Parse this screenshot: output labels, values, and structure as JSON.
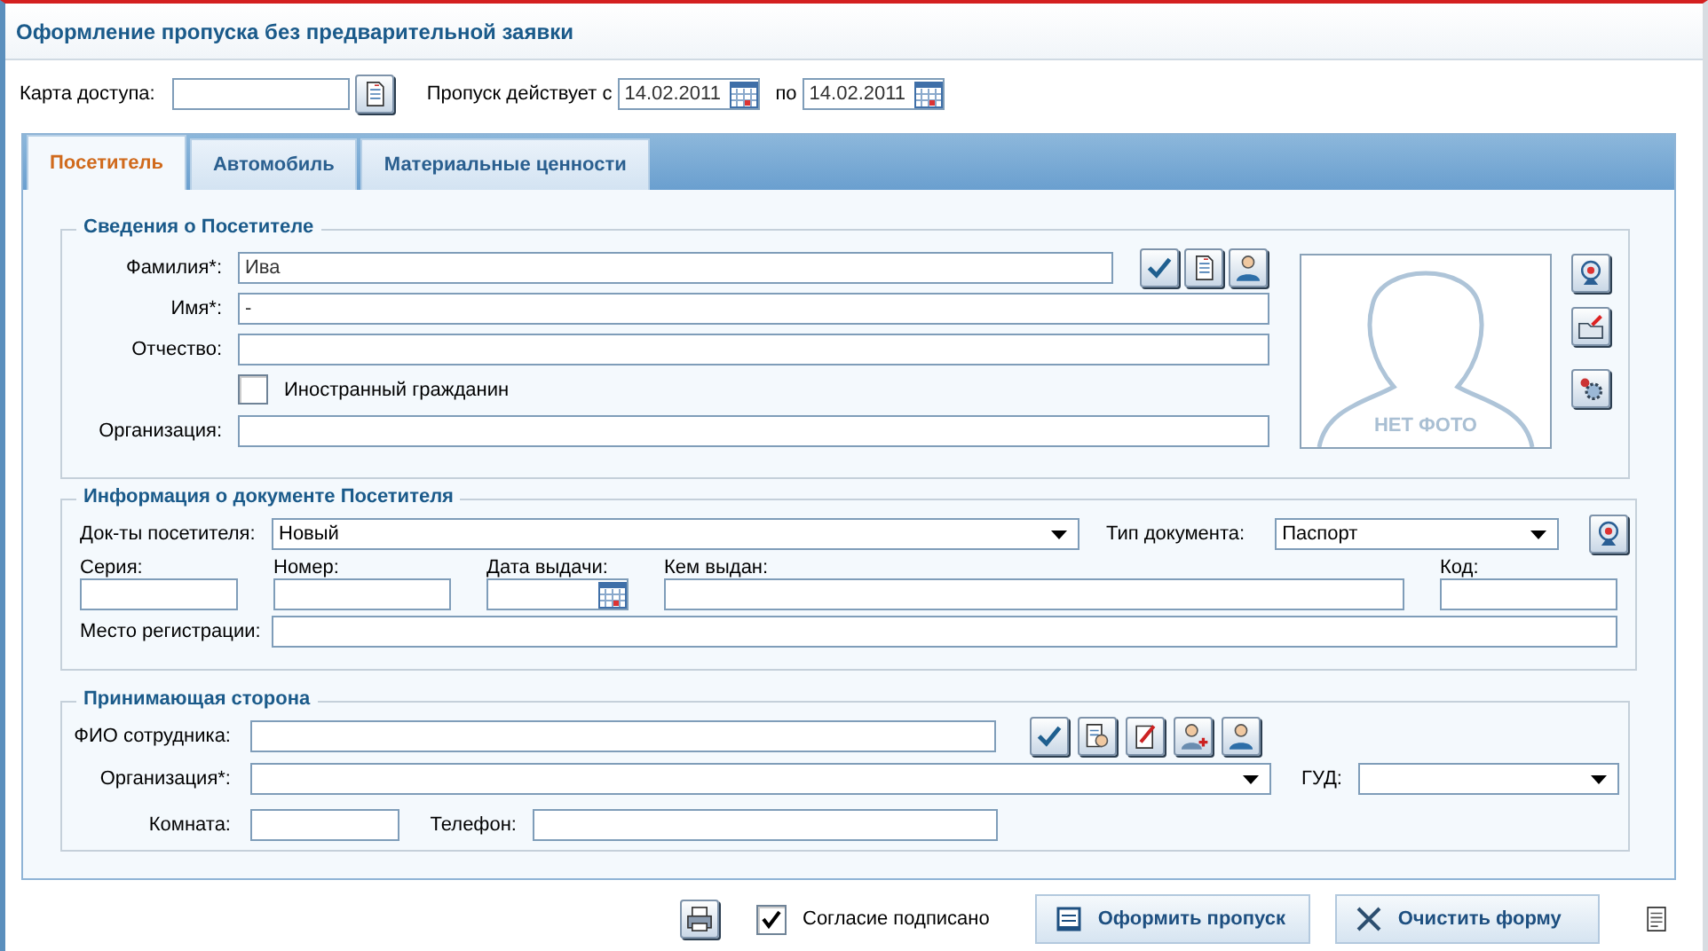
{
  "title": "Оформление пропуска без предварительной заявки",
  "access_card": {
    "label": "Карта доступа:"
  },
  "validity": {
    "label": "Пропуск действует с",
    "from": "14.02.2011",
    "to_label": "по",
    "to": "14.02.2011"
  },
  "tabs": [
    {
      "label": "Посетитель",
      "selected": true
    },
    {
      "label": "Автомобиль",
      "selected": false
    },
    {
      "label": "Материальные ценности",
      "selected": false
    }
  ],
  "visitor": {
    "legend": "Сведения о Посетителе",
    "surname": {
      "label": "Фамилия*:",
      "value": "Ива"
    },
    "name": {
      "label": "Имя*:",
      "value": "-"
    },
    "patronymic": {
      "label": "Отчество:"
    },
    "foreign": {
      "label": "Иностранный гражданин",
      "checked": false
    },
    "organization": {
      "label": "Организация:"
    },
    "photo": {
      "caption": "НЕТ ФОТО"
    }
  },
  "document": {
    "legend": "Информация о документе Посетителя",
    "docs": {
      "label": "Док-ты посетителя:",
      "value": "Новый"
    },
    "doc_type": {
      "label": "Тип документа:",
      "value": "Паспорт"
    },
    "series": {
      "label": "Серия:"
    },
    "number": {
      "label": "Номер:"
    },
    "issue_date": {
      "label": "Дата выдачи:"
    },
    "issued_by": {
      "label": "Кем выдан:"
    },
    "code": {
      "label": "Код:"
    },
    "registration": {
      "label": "Место регистрации:"
    }
  },
  "host": {
    "legend": "Принимающая сторона",
    "employee": {
      "label": "ФИО сотрудника:"
    },
    "organization": {
      "label": "Организация*:"
    },
    "gud": {
      "label": "ГУД:"
    },
    "room": {
      "label": "Комната:"
    },
    "phone": {
      "label": "Телефон:"
    }
  },
  "footer": {
    "consent": {
      "label": "Согласие подписано",
      "checked": true
    },
    "buttons": [
      {
        "label": "Оформить пропуск",
        "kind": "issue"
      },
      {
        "label": "Очистить форму",
        "kind": "clear"
      }
    ]
  }
}
